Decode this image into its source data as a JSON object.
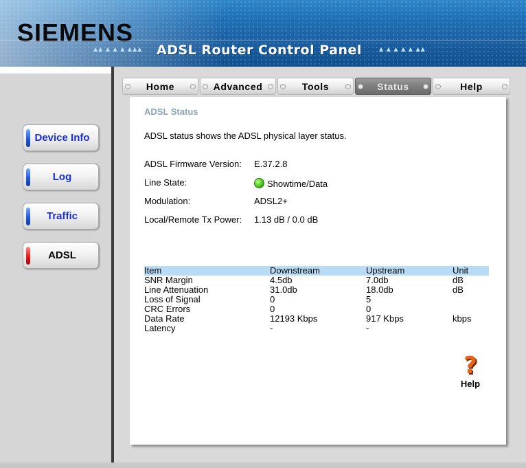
{
  "header": {
    "logo": "SIEMENS",
    "title": "ADSL Router Control Panel",
    "arrows_left": "▲▲ ▲ ▲ ▲ ▲▲▲",
    "arrows_right": "▲ ▲ ▲ ▲ ▲ ▲▲"
  },
  "tabs": [
    {
      "label": "Home"
    },
    {
      "label": "Advanced"
    },
    {
      "label": "Tools"
    },
    {
      "label": "Status",
      "active": true
    },
    {
      "label": "Help"
    }
  ],
  "sidebar": {
    "items": [
      {
        "label": "Device Info"
      },
      {
        "label": "Log"
      },
      {
        "label": "Traffic"
      },
      {
        "label": "ADSL",
        "active": true
      }
    ]
  },
  "panel": {
    "title": "ADSL Status",
    "description": "ADSL status shows the ADSL physical layer status.",
    "info": {
      "firmware_label": "ADSL Firmware Version:",
      "firmware_value": "E.37.2.8",
      "line_state_label": "Line State:",
      "line_state_value": "Showtime/Data",
      "modulation_label": "Modulation:",
      "modulation_value": "ADSL2+",
      "tx_power_label": "Local/Remote Tx Power:",
      "tx_power_value": "1.13 dB / 0.0 dB"
    },
    "table": {
      "headers": [
        "Item",
        "Downstream",
        "Upstream",
        "Unit"
      ],
      "rows": [
        [
          "SNR Margin",
          "4.5db",
          "7.0db",
          "dB"
        ],
        [
          "Line Attenuation",
          "31.0db",
          "18.0db",
          "dB"
        ],
        [
          "Loss of Signal",
          "0",
          "5",
          ""
        ],
        [
          "CRC Errors",
          "0",
          "0",
          ""
        ],
        [
          "Data Rate",
          "12193 Kbps",
          "917 Kbps",
          "kbps"
        ],
        [
          "Latency",
          "-",
          "-",
          ""
        ]
      ]
    },
    "help": {
      "icon_glyph": "?",
      "label": "Help"
    }
  },
  "colors": {
    "banner": "#1f6fb5",
    "active_tab": "#7d7d7d",
    "nav_text": "#1a2fd6",
    "table_header": "#b9dcf6",
    "panel_title": "#8aa3b8",
    "status_led": "#55d222",
    "help_icon": "#e8641c"
  },
  "icons": {
    "line_state": "green-led-icon",
    "help": "question-mark-icon"
  }
}
